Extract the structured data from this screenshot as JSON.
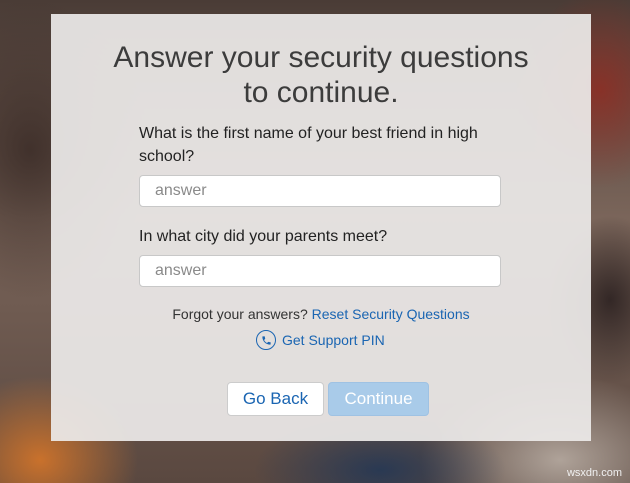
{
  "page": {
    "title_line1": "Answer your security questions",
    "title_line2": "to continue."
  },
  "questions": [
    {
      "label": "What is the first name of your best friend in high school?",
      "placeholder": "answer",
      "value": ""
    },
    {
      "label": "In what city did your parents meet?",
      "placeholder": "answer",
      "value": ""
    }
  ],
  "forgot": {
    "text": "Forgot your answers?",
    "link_label": "Reset Security Questions"
  },
  "support": {
    "icon": "phone-icon",
    "label": "Get Support PIN"
  },
  "buttons": {
    "back_label": "Go Back",
    "continue_label": "Continue",
    "continue_enabled": false
  },
  "watermark": "wsxdn.com",
  "colors": {
    "link": "#1a65b2",
    "continue_disabled": "#a9cbe9",
    "panel": "#eceae8"
  }
}
